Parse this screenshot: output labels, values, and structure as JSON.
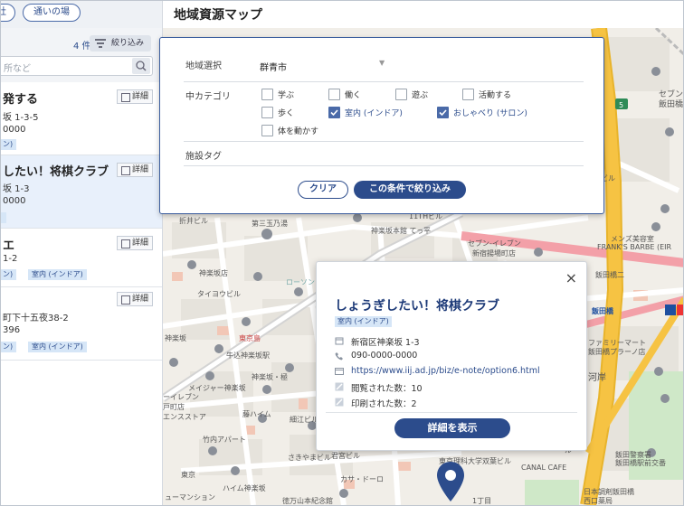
{
  "header": {
    "title": "地域資源マップ"
  },
  "sidebar": {
    "tabs": [
      "社",
      "通いの場"
    ],
    "count": "4 件",
    "filter_label": "絞り込み",
    "search_placeholder": "所など",
    "cards": [
      {
        "title": "発する",
        "address": "坂 1-3-5",
        "phone": "0000",
        "tags": [
          "ン)"
        ],
        "detail_label": "詳細"
      },
      {
        "title": "したい！将棋クラブ",
        "address": "坂 1-3",
        "phone": "0000",
        "tags": [
          ""
        ],
        "detail_label": "詳細"
      },
      {
        "title": "エ",
        "address": "1-2",
        "phone": "",
        "tags": [
          "ン)",
          "室内 (インドア)"
        ],
        "detail_label": "詳細"
      },
      {
        "title": "",
        "address": "町下十五夜38-2",
        "phone": "396",
        "tags": [
          "ン)",
          "室内 (インドア)"
        ],
        "detail_label": "詳細"
      }
    ]
  },
  "filter_dialog": {
    "region_label": "地域選択",
    "region_value": "群青市",
    "category_label": "中カテゴリ",
    "categories": [
      {
        "label": "学ぶ",
        "checked": false
      },
      {
        "label": "働く",
        "checked": false
      },
      {
        "label": "遊ぶ",
        "checked": false
      },
      {
        "label": "活動する",
        "checked": false
      },
      {
        "label": "歩く",
        "checked": false
      },
      {
        "label": "室内 (インドア)",
        "checked": true
      },
      {
        "label": "おしゃべり (サロン)",
        "checked": true
      },
      {
        "label": "体を動かす",
        "checked": false
      }
    ],
    "tag_label": "施設タグ",
    "clear_label": "クリア",
    "apply_label": "この条件で絞り込み"
  },
  "popup": {
    "title": "しょうぎしたい！将棋クラブ",
    "tag": "室内 (インドア)",
    "address": "新宿区神楽坂 1-3",
    "phone": "090-0000-0000",
    "url": "https://www.iij.ad.jp/biz/e-note/option6.html",
    "views": "閲覧された数：10",
    "prints": "印刷された数：2",
    "detail_button": "詳細を表示",
    "close": "×"
  },
  "map_labels": {
    "l1": "第三玉乃湯",
    "l2": "神楽坂本館 てっ平",
    "l3": "11THビル",
    "l4": "セブン-イレブン",
    "l5": "新宿揚場町店",
    "l6": "メンズ美容室",
    "l7": "FRANK'S BARBE (EIR",
    "l8": "飯田橋二",
    "l9": "飯田橋",
    "l10": "ファミリーマート",
    "l11": "飯田橋プラーノ店",
    "l12": "河岸",
    "l13": "神楽坂店",
    "l14": "東京島",
    "l15": "牛込神楽坂駅",
    "l16": "神楽坂・極",
    "l17": "メイジャー神楽坂",
    "l18": "藤ハイム",
    "l19": "細江ビル",
    "l20": "竹内アパート",
    "l21": "さきやまビル",
    "l22": "ハイム神楽坂",
    "l23": "東京理科大学双葉ビル",
    "l24": "CANAL CAFE",
    "l25": "飯田警察署",
    "l26": "飯田橋駅前交番",
    "l27": "日本調剤飯田橋",
    "l28": "西口薬局",
    "l29": "1丁目",
    "l30": "セブン",
    "l31": "飯田橋",
    "l32": "折井ビル",
    "l33": "タイヨウビル",
    "l34": "ローソン",
    "l35": "神楽坂",
    "l36": "ーイレブン",
    "l37": "戸町店",
    "l38": "エンスストア",
    "l39": "君宮ビル",
    "l40": "カサ・ドーロ",
    "l41": "ューマンション",
    "l42": "徳万山本紀念館",
    "l43": "ビル",
    "l44": "東京",
    "l45": "ル"
  },
  "colors": {
    "primary": "#2c4c8c",
    "tag_bg": "#d6e6f7",
    "map_bg": "#f2efe9",
    "road_major": "#f6c343"
  }
}
